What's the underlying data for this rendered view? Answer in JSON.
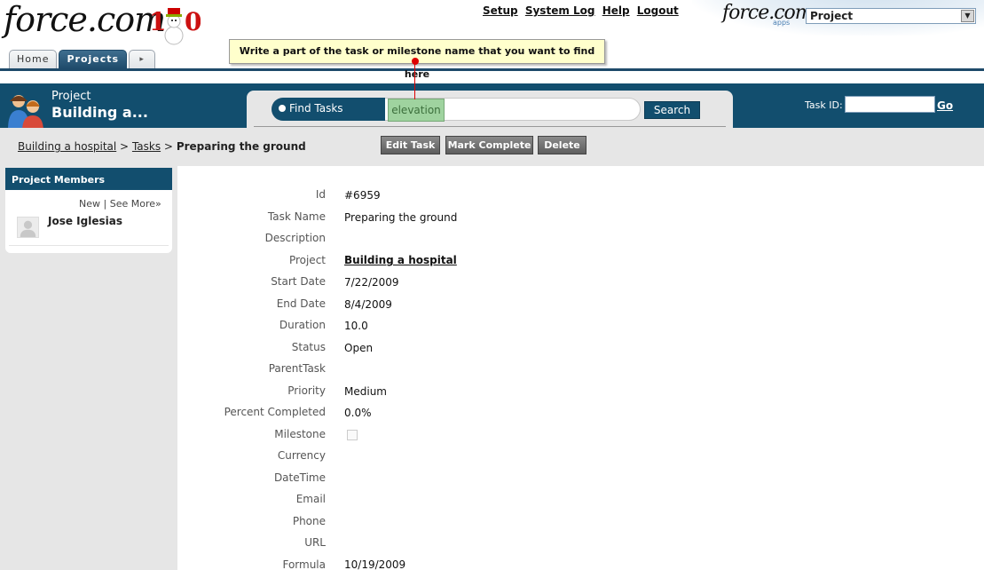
{
  "header": {
    "logo_text": "force.com",
    "logo_number": "10",
    "tabs": [
      {
        "label": "Home"
      },
      {
        "label": "Projects"
      },
      {
        "label": "▸"
      }
    ],
    "links": [
      "Setup",
      "System Log",
      "Help",
      "Logout"
    ],
    "apps_logo": "force.com",
    "apps_sub": "apps",
    "app_selector": "Project",
    "tooltip": "Write a part of the task or milestone name that you want to find here"
  },
  "band": {
    "project_label": "Project",
    "project_name": "Building a...",
    "find_label": "Find Tasks",
    "search_value": "elevation",
    "search_button": "Search",
    "task_id_label": "Task ID:",
    "go_label": "Go"
  },
  "breadcrumb": {
    "project": "Building a hospital",
    "sep1": ">",
    "tasks": "Tasks",
    "sep2": ">",
    "current": "Preparing the ground"
  },
  "actions": {
    "edit": "Edit Task",
    "complete": "Mark Complete",
    "delete": "Delete"
  },
  "sidebar": {
    "title": "Project Members",
    "new_link": "New",
    "link_sep": "|",
    "see_more": "See More»",
    "member": "Jose Iglesias"
  },
  "details": {
    "fields": [
      {
        "label": "Id",
        "value": "#6959"
      },
      {
        "label": "Task Name",
        "value": "Preparing the ground"
      },
      {
        "label": "Description",
        "value": ""
      },
      {
        "label": "Project",
        "value": "Building a hospital"
      },
      {
        "label": "Start Date",
        "value": "7/22/2009"
      },
      {
        "label": "End Date",
        "value": "8/4/2009"
      },
      {
        "label": "Duration",
        "value": "10.0"
      },
      {
        "label": "Status",
        "value": "Open"
      },
      {
        "label": "ParentTask",
        "value": ""
      },
      {
        "label": "Priority",
        "value": "Medium"
      },
      {
        "label": "Percent Completed",
        "value": "0.0%"
      },
      {
        "label": "Milestone",
        "value": ""
      },
      {
        "label": "Currency",
        "value": ""
      },
      {
        "label": "DateTime",
        "value": ""
      },
      {
        "label": "Email",
        "value": ""
      },
      {
        "label": "Phone",
        "value": ""
      },
      {
        "label": "URL",
        "value": ""
      },
      {
        "label": "Formula",
        "value": "10/19/2009"
      }
    ]
  }
}
